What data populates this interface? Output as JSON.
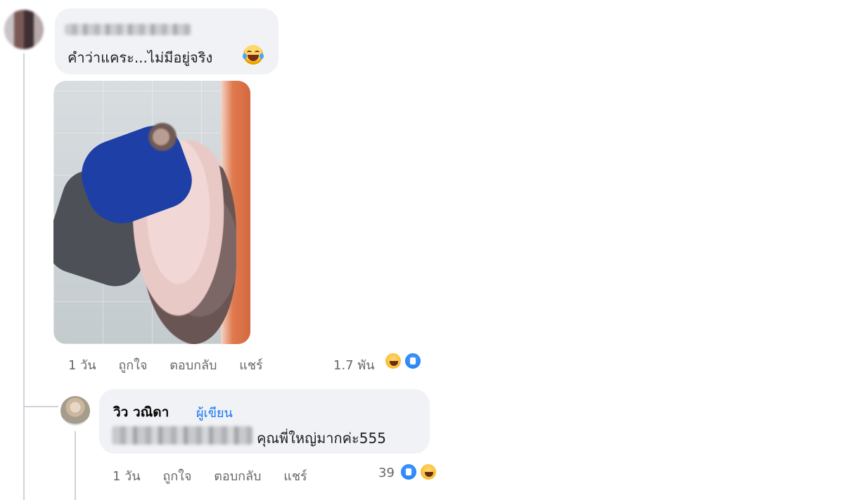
{
  "comment_1": {
    "author_redacted": true,
    "text": "คำว่าแคระ...ไม่มีอยู่จริง",
    "meta": {
      "time": "1 วัน",
      "like_label": "ถูกใจ",
      "reply_label": "ตอบกลับ",
      "share_label": "แชร์",
      "reaction_count": "1.7 พัน"
    }
  },
  "reply_1": {
    "author": "วิว วณิดา",
    "author_badge": "ผู้เขียน",
    "text": "คุณพี่ใหญ่มากค่ะ555",
    "meta": {
      "time": "1 วัน",
      "like_label": "ถูกใจ",
      "reply_label": "ตอบกลับ",
      "share_label": "แชร์",
      "reaction_count": "39"
    }
  },
  "icons": [
    "laughing-emoji-icon",
    "like-reaction-icon",
    "haha-reaction-icon"
  ],
  "colors": {
    "bubble": "#f0f2f5",
    "meta_text": "#65676b",
    "author_badge": "#1877f2",
    "thread_line": "#cfd3d8"
  }
}
